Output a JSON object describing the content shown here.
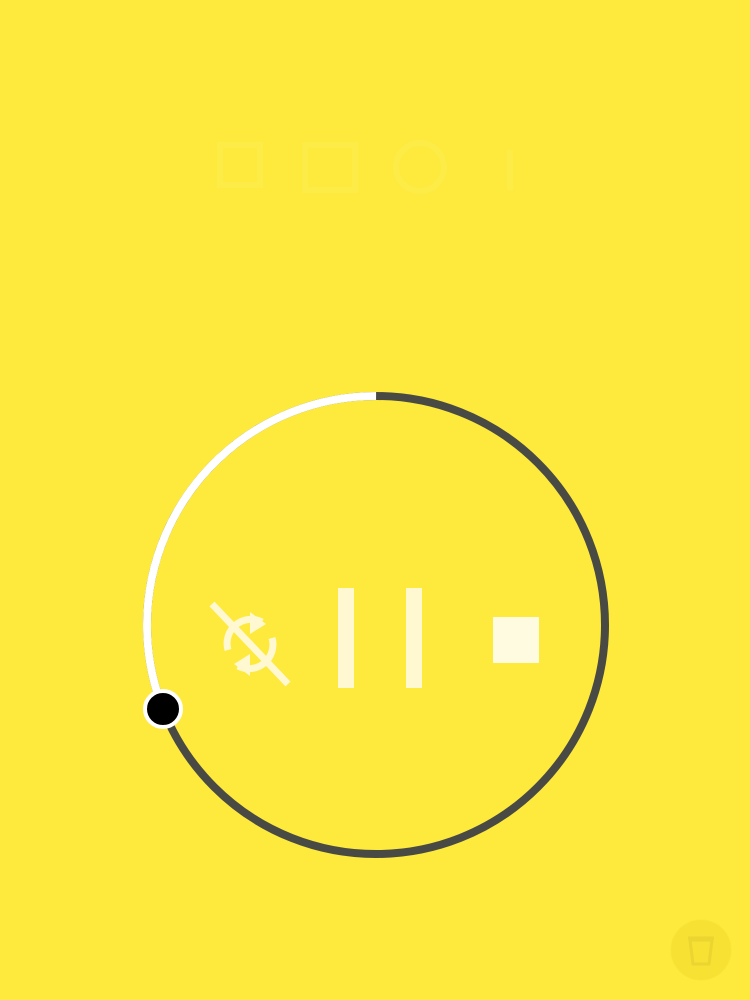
{
  "app": {
    "accent_color": "#fdea3c",
    "ring_track_color": "#4a4a44",
    "ring_progress_color": "#ffffff",
    "knob_color": "#000000"
  },
  "timer": {
    "progress_fraction": 0.31
  },
  "controls": {
    "loop_icon": "repeat-off-icon",
    "pause_icon": "pause-icon",
    "stop_icon": "stop-icon"
  },
  "fab": {
    "icon": "cup-icon"
  }
}
